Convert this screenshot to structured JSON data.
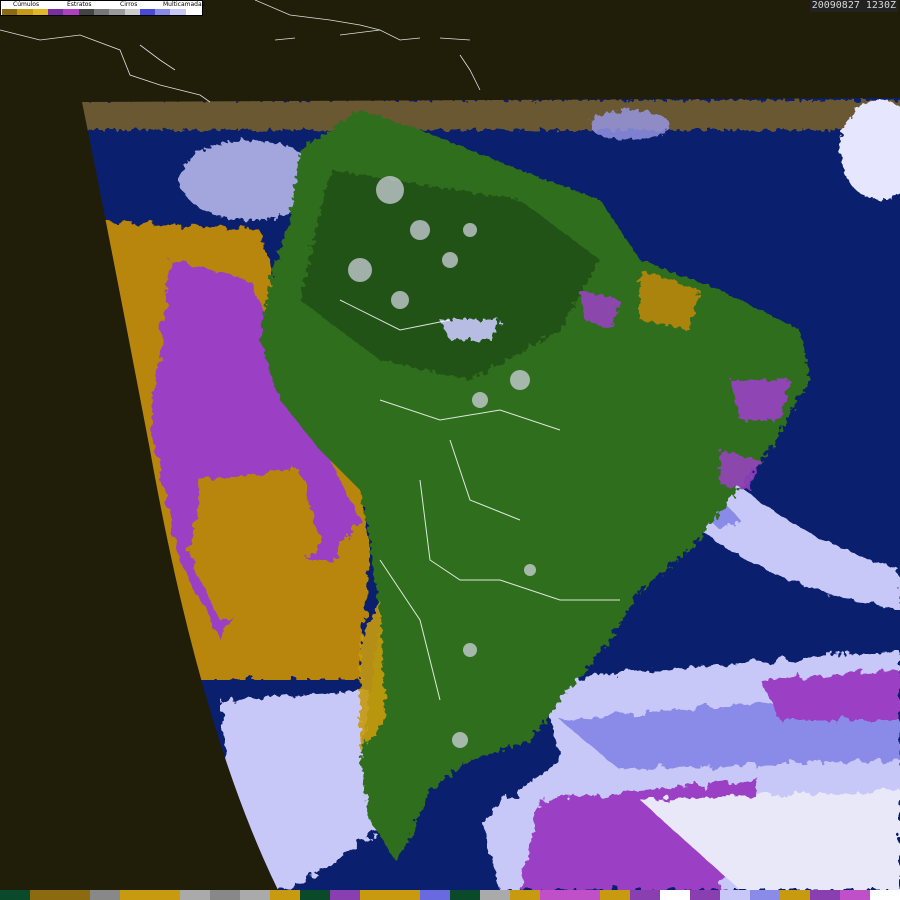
{
  "timestamp": "20090827 1230Z",
  "legend": {
    "labels": [
      "Cúmulos",
      "Estratos",
      "Cirros",
      "Multicamadas"
    ],
    "swatches": [
      "#8c6a10",
      "#c89a10",
      "#e2b820",
      "#7a2fa0",
      "#b23fbf",
      "#444444",
      "#777777",
      "#9a9a9a",
      "#cccccc",
      "#4a4ad8",
      "#8a8ae8",
      "#c8c8f8",
      "#ffffff"
    ]
  },
  "colors": {
    "space": "#201d08",
    "ocean": "#0a1f6e",
    "land_green": "#2f6e1e",
    "land_dark": "#1e4d14",
    "cumulus": "#b8860b",
    "stratus": "#9b3fc4",
    "cirrus_light": "#c8c8f8",
    "cirrus_mid": "#8a8ae8",
    "multilayer": "#ffffff",
    "border_lines": "#ffffff"
  },
  "palette_bar": [
    "#0a4a2a",
    "#8c6a10",
    "#8c6a10",
    "#888888",
    "#c89a10",
    "#c89a10",
    "#aaaaaa",
    "#888888",
    "#aaaaaa",
    "#c89a10",
    "#0a4a2a",
    "#8a3fb0",
    "#c89a10",
    "#c89a10",
    "#6a6ae0",
    "#0a4a2a",
    "#aaaaaa",
    "#c89a10",
    "#c050c8",
    "#c050c8",
    "#c89a10",
    "#8a3fb0",
    "#ffffff",
    "#8a3fb0",
    "#c8c8f8",
    "#8a8ae8",
    "#c89a10",
    "#8a3fb0",
    "#c050c8",
    "#ffffff"
  ]
}
